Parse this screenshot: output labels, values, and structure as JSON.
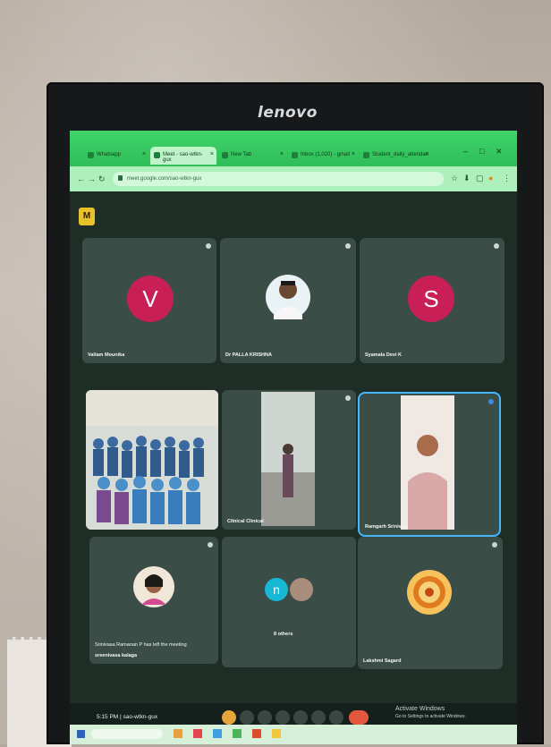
{
  "monitor": {
    "brand": "lenovo"
  },
  "browser": {
    "tabs": [
      "Whatsapp",
      "Meet - sao-wtkn-gux",
      "New Tab",
      "Inbox (1,020) - gmail",
      "Student_daily_attendan"
    ],
    "window_controls": [
      "–",
      "□",
      "✕"
    ],
    "url": "meet.google.com/sao-wtkn-gux",
    "nav_icons": [
      "←",
      "→",
      "↻"
    ],
    "extension_icons": [
      "☆",
      "⬇",
      "▢",
      "●",
      "⋮"
    ]
  },
  "meet": {
    "badge": "M",
    "tiles": [
      {
        "name": "Vallam Mounika",
        "letter": "V",
        "kind": "letter"
      },
      {
        "name": "Dr PALLA KRISHNA",
        "kind": "photo-man"
      },
      {
        "name": "Syamala Devi K",
        "letter": "S",
        "kind": "letter"
      },
      {
        "name": "",
        "kind": "group-photo"
      },
      {
        "name": "Clinical Clinical",
        "kind": "video-room"
      },
      {
        "name": "Ramgarh Srinivas",
        "kind": "video-man",
        "highlighted": true
      },
      {
        "name": "Srinivasa Ramanan P has left the meeting",
        "sub": "sreenivasa kalaga",
        "kind": "photo-child"
      },
      {
        "name": "8 others",
        "letter": "n",
        "kind": "others"
      },
      {
        "name": "Lakshmi Sagard",
        "kind": "mandala"
      }
    ]
  },
  "controls": {
    "time": "5:15 PM | sao-wtkn-gux",
    "activate_line1": "Activate Windows",
    "activate_line2": "Go to Settings to activate Windows."
  },
  "colors": {
    "tab_green": "#3fd46a",
    "tile_bg": "#3b4d47",
    "avatar_pink": "#c71f56",
    "end_call": "#e4573f",
    "highlight_blue": "#46b6ff"
  }
}
